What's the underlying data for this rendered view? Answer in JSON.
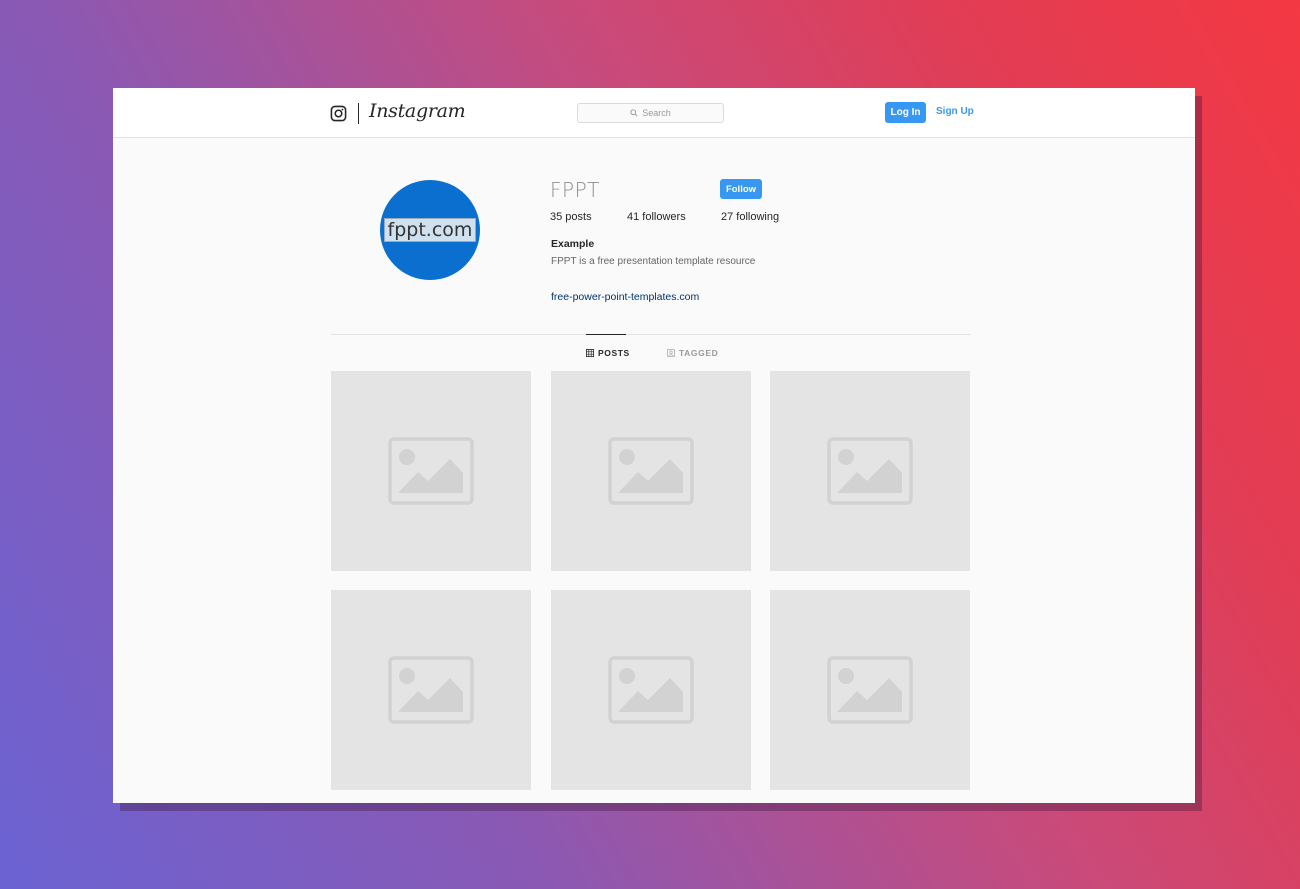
{
  "header": {
    "brand": "Instagram",
    "search_placeholder": "Search",
    "login_label": "Log In",
    "signup_label": "Sign Up"
  },
  "profile": {
    "avatar_text": "fppt.com",
    "username": "FPPT",
    "follow_label": "Follow",
    "stats": {
      "posts": "35 posts",
      "followers": "41 followers",
      "following": "27 following"
    },
    "bio_name": "Example",
    "bio_text": "FPPT is a free presentation template resource",
    "website": "free-power-point-templates.com"
  },
  "tabs": [
    {
      "label": "POSTS",
      "icon": "grid-icon",
      "active": true
    },
    {
      "label": "TAGGED",
      "icon": "tag-icon",
      "active": false
    }
  ],
  "posts": [
    {
      "icon": "image-placeholder-icon"
    },
    {
      "icon": "image-placeholder-icon"
    },
    {
      "icon": "image-placeholder-icon"
    },
    {
      "icon": "image-placeholder-icon"
    },
    {
      "icon": "image-placeholder-icon"
    },
    {
      "icon": "image-placeholder-icon"
    }
  ],
  "colors": {
    "accent": "#3897f0",
    "link": "#003569",
    "avatar_bg": "#0a6fcf",
    "tile_bg": "#e4e4e4"
  }
}
